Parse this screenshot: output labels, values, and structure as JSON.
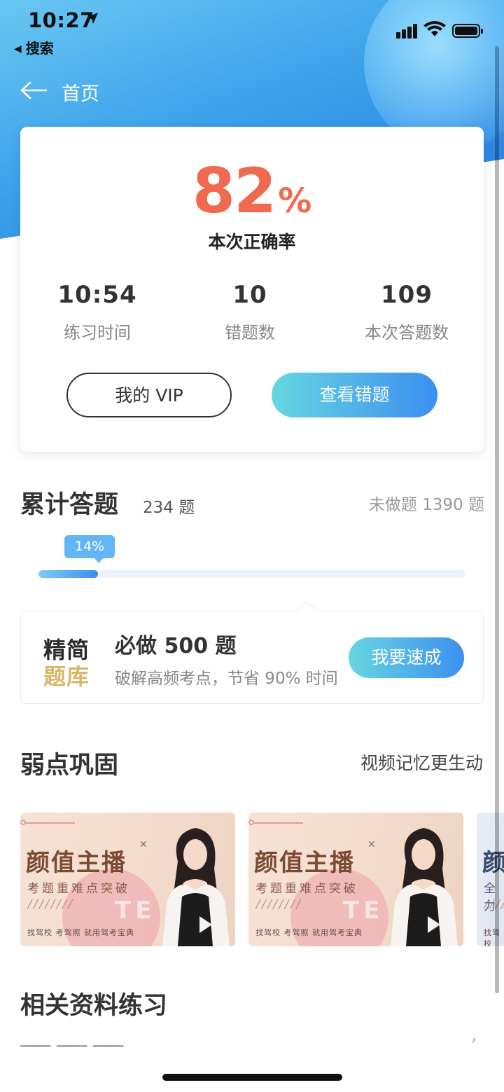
{
  "status_bar": {
    "time": "10:27",
    "back_app": "搜索"
  },
  "nav": {
    "title": "首页"
  },
  "result_card": {
    "accuracy_value": "82",
    "accuracy_symbol": "%",
    "accuracy_label": "本次正确率",
    "stats": [
      {
        "value": "10:54",
        "label": "练习时间"
      },
      {
        "value": "10",
        "label": "错题数"
      },
      {
        "value": "109",
        "label": "本次答题数"
      }
    ],
    "vip_button": "我的 VIP",
    "review_button": "查看错题"
  },
  "cumulative": {
    "title": "累计答题",
    "count": "234 题",
    "undone": "未做题 1390 题",
    "progress_label": "14%",
    "progress": 0.14
  },
  "promo": {
    "logo_line1": "精简",
    "logo_line2": "题库",
    "title": "必做 500 题",
    "subtitle": "破解高频考点，节省 90% 时间",
    "button": "我要速成"
  },
  "weak_points": {
    "title": "弱点巩固",
    "subtitle": "视频记忆更生动",
    "videos": [
      {
        "title": "颜值主播",
        "subtitle": "考题重难点突破",
        "footer": "找驾校  考驾照  就用驾考宝典"
      },
      {
        "title": "颜值主播",
        "subtitle": "考题重难点突破",
        "footer": "找驾校  考驾照  就用驾考宝典"
      },
      {
        "title": "颜",
        "subtitle": "全力",
        "footer": "找驾校"
      }
    ]
  },
  "related": {
    "title": "相关资料练习"
  },
  "colors": {
    "accent_orange": "#ef6a4e",
    "gradient_start": "#67d6e0",
    "gradient_end": "#3b8ff0",
    "hero_blue": "#2b7fe3"
  }
}
